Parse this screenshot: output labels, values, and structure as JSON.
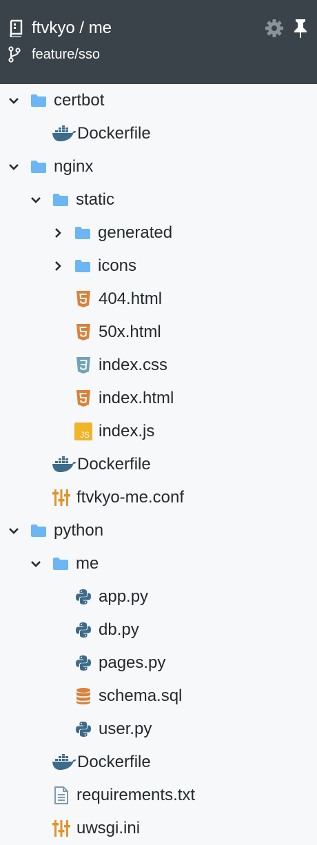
{
  "header": {
    "repo_title": "ftvkyo / me",
    "branch": "feature/sso",
    "repo_icon": "repo-book-icon",
    "branch_icon": "git-branch-icon",
    "settings_icon": "gear-icon",
    "pin_icon": "pin-icon"
  },
  "colors": {
    "header_bg": "#3b434a",
    "folder": "#6cb6f5",
    "html": "#d9823b",
    "css": "#6fa4b8",
    "js": "#f0b429",
    "python": "#3d6b8a",
    "docker": "#3d6b8a",
    "config": "#e0952b"
  },
  "tree": [
    {
      "label": "certbot",
      "type": "folder",
      "expanded": true
    },
    {
      "label": "Dockerfile",
      "type": "docker"
    },
    {
      "label": "nginx",
      "type": "folder",
      "expanded": true
    },
    {
      "label": "static",
      "type": "folder",
      "expanded": true
    },
    {
      "label": "generated",
      "type": "folder",
      "expanded": false
    },
    {
      "label": "icons",
      "type": "folder",
      "expanded": false
    },
    {
      "label": "404.html",
      "type": "html"
    },
    {
      "label": "50x.html",
      "type": "html"
    },
    {
      "label": "index.css",
      "type": "css"
    },
    {
      "label": "index.html",
      "type": "html"
    },
    {
      "label": "index.js",
      "type": "js"
    },
    {
      "label": "Dockerfile",
      "type": "docker"
    },
    {
      "label": "ftvkyo-me.conf",
      "type": "config"
    },
    {
      "label": "python",
      "type": "folder",
      "expanded": true
    },
    {
      "label": "me",
      "type": "folder",
      "expanded": true
    },
    {
      "label": "app.py",
      "type": "python"
    },
    {
      "label": "db.py",
      "type": "python"
    },
    {
      "label": "pages.py",
      "type": "python"
    },
    {
      "label": "schema.sql",
      "type": "database"
    },
    {
      "label": "user.py",
      "type": "python"
    },
    {
      "label": "Dockerfile",
      "type": "docker"
    },
    {
      "label": "requirements.txt",
      "type": "text"
    },
    {
      "label": "uwsgi.ini",
      "type": "config"
    }
  ]
}
